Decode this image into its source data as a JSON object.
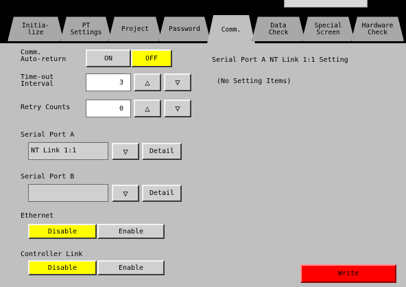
{
  "colors": {
    "panel": "#c0c0c0",
    "selected": "#ffff00",
    "write": "#ff0000"
  },
  "tabs": [
    "Initia-\nlize",
    "PT\nSettings",
    "Project",
    "Password",
    "Comm.",
    "Data\nCheck",
    "Special\nScreen",
    "Hardware\nCheck"
  ],
  "active_tab": "Comm.",
  "comm_auto_return": {
    "label": "Comm.\nAuto-return",
    "on": "ON",
    "off": "OFF",
    "selected": "OFF"
  },
  "timeout": {
    "label": "Time-out\nInterval",
    "value": "3",
    "up": "△",
    "down": "▽"
  },
  "retry": {
    "label": "Retry Counts",
    "value": "0",
    "up": "△",
    "down": "▽"
  },
  "serial_a": {
    "label": "Serial Port A",
    "value": "NT Link 1:1",
    "dropdown": "▽",
    "detail": "Detail"
  },
  "serial_b": {
    "label": "Serial Port B",
    "value": "",
    "dropdown": "▽",
    "detail": "Detail"
  },
  "ethernet": {
    "label": "Ethernet",
    "disable": "Disable",
    "enable": "Enable",
    "selected": "Disable"
  },
  "controller_link": {
    "label": "Controller Link",
    "disable": "Disable",
    "enable": "Enable",
    "selected": "Disable"
  },
  "info": {
    "title": "Serial Port A NT Link 1:1 Setting",
    "note": "(No Setting Items)"
  },
  "write_label": "Write"
}
